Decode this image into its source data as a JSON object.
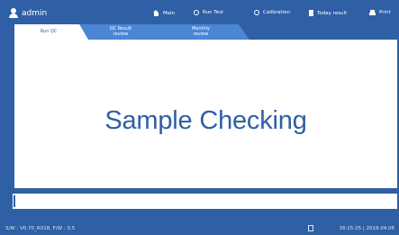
{
  "header": {
    "user": "admin",
    "nav": [
      {
        "label": "Main",
        "icon": "home-icon"
      },
      {
        "label": "Run Test",
        "icon": "circle-icon"
      },
      {
        "label": "Calibration",
        "icon": "circle-icon"
      },
      {
        "label": "Today result",
        "icon": "document-icon"
      },
      {
        "label": "Print",
        "icon": "printer-icon"
      }
    ]
  },
  "tabs": [
    {
      "line1": "Run QC",
      "line2": ""
    },
    {
      "line1": "QC Result",
      "line2": "review"
    },
    {
      "line1": "Monthly",
      "line2": "review"
    }
  ],
  "main": {
    "message": "Sample Checking"
  },
  "progress": {
    "value": 0.003
  },
  "footer": {
    "version": "S/W : V0.70_R018, F/W : 0.5",
    "datetime": "16:15:25 | 2018.04.06"
  },
  "colors": {
    "primary": "#2f5fa5",
    "tab_inactive": "#4a86d4",
    "panel": "#ffffff"
  }
}
